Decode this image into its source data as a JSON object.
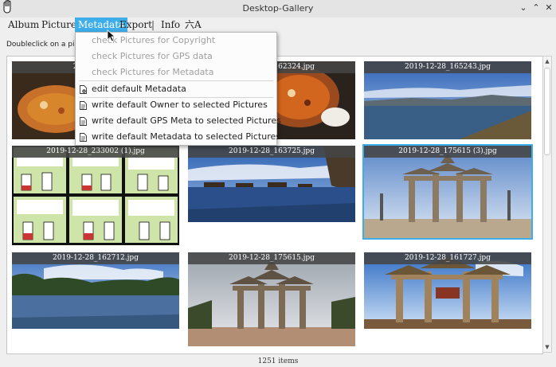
{
  "window": {
    "title": "Desktop-Gallery",
    "minimize_glyph": "⌄",
    "maximize_glyph": "⌃",
    "close_glyph": "✕"
  },
  "menubar": {
    "items": [
      "Album",
      "Pictures",
      "Metadata",
      "Export",
      "Info"
    ],
    "separator": "|",
    "lang_label": "六A",
    "active": "Metadata"
  },
  "hint_text": "Doubleclick on a picture",
  "metadata_menu": {
    "items": [
      {
        "label": "check Pictures for Copyright",
        "enabled": false,
        "icon": ""
      },
      {
        "label": "check Pictures for GPS data",
        "enabled": false,
        "icon": ""
      },
      {
        "label": "check Pictures for Metadata",
        "enabled": false,
        "icon": ""
      },
      {
        "label": "edit default Metadata",
        "enabled": true,
        "icon": "settings-file-icon"
      },
      {
        "label": "write default Owner to selected Pictures",
        "enabled": true,
        "icon": "document-icon"
      },
      {
        "label": "write default GPS Meta to selected Pictures",
        "enabled": true,
        "icon": "document-icon"
      },
      {
        "label": "write default Metadata to selected Pictures",
        "enabled": true,
        "icon": "document-icon"
      }
    ]
  },
  "gallery": {
    "thumbnails": [
      {
        "caption": "2019-12-28_",
        "scene": "food",
        "selected": false
      },
      {
        "caption": "2019-12-28_162324.jpg",
        "scene": "food",
        "selected": false
      },
      {
        "caption": "2019-12-28_165243.jpg",
        "scene": "lake-evening",
        "selected": false
      },
      {
        "caption": "2019-12-28_233002 (1).jpg",
        "scene": "comic",
        "selected": false
      },
      {
        "caption": "2019-12-28_163725.jpg",
        "scene": "lake-boats",
        "selected": false
      },
      {
        "caption": "2019-12-28_175615 (3).jpg",
        "scene": "arch-sky",
        "selected": true
      },
      {
        "caption": "2019-12-28_162712.jpg",
        "scene": "lake-trees",
        "selected": false
      },
      {
        "caption": "2019-12-28_175615.jpg",
        "scene": "arch-cloudy",
        "selected": false
      },
      {
        "caption": "2019-12-28_161727.jpg",
        "scene": "arch-blue",
        "selected": false
      }
    ]
  },
  "status": {
    "items_count": "1251 items"
  },
  "colors": {
    "accent": "#3daee9"
  }
}
